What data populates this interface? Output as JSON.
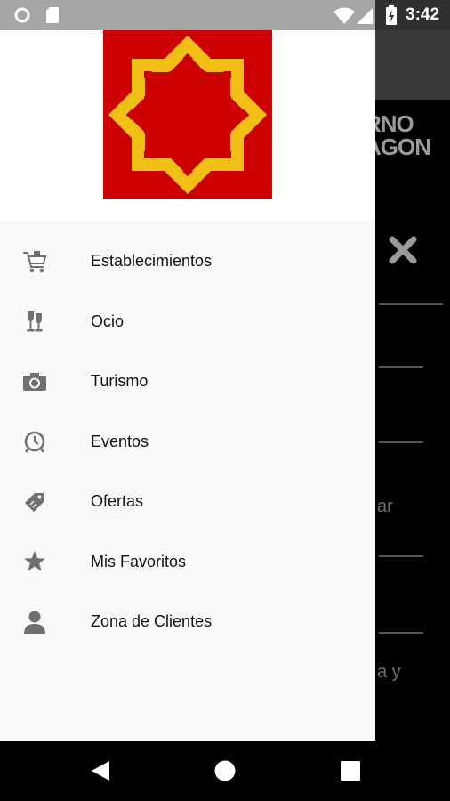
{
  "status_bar": {
    "time": "3:42"
  },
  "background_app": {
    "brand_line1": "RNO",
    "brand_line2": "AGON",
    "fragment1": "ar",
    "fragment2": "a y"
  },
  "drawer": {
    "menu": [
      {
        "label": "Establecimientos",
        "icon": "shopping-cart-icon"
      },
      {
        "label": "Ocio",
        "icon": "wine-glass-icon"
      },
      {
        "label": "Turismo",
        "icon": "camera-icon"
      },
      {
        "label": "Eventos",
        "icon": "alarm-clock-icon"
      },
      {
        "label": "Ofertas",
        "icon": "tags-icon"
      },
      {
        "label": "Mis Favoritos",
        "icon": "star-icon"
      },
      {
        "label": "Zona de Clientes",
        "icon": "person-icon"
      }
    ]
  },
  "colors": {
    "logo_red": "#cc0000",
    "logo_star": "#f2bf16",
    "icon_gray": "#707070"
  }
}
